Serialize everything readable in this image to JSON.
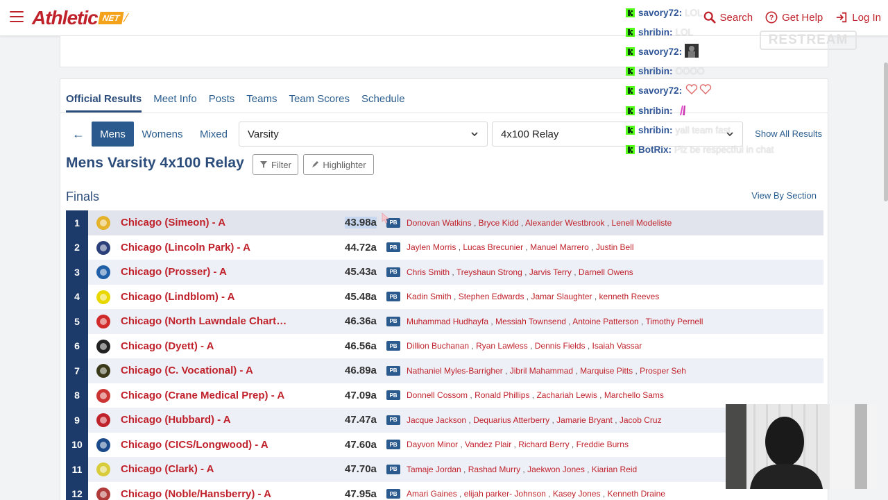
{
  "header": {
    "logo_main": "thletic",
    "logo_letter": "A",
    "logo_net": "NET",
    "links": [
      {
        "label": "Search",
        "icon": "search-icon"
      },
      {
        "label": "Get Help",
        "icon": "help-icon"
      },
      {
        "label": "Log In",
        "icon": "login-icon"
      }
    ]
  },
  "tabs": [
    "Official Results",
    "Meet Info",
    "Posts",
    "Teams",
    "Team Scores",
    "Schedule"
  ],
  "filters": {
    "genders": [
      "Mens",
      "Womens",
      "Mixed"
    ],
    "division": "Varsity",
    "event": "4x100 Relay",
    "show_all": "Show All Results"
  },
  "event_title": "Mens Varsity 4x100 Relay",
  "buttons": {
    "filter": "Filter",
    "highlighter": "Highlighter"
  },
  "section": {
    "title": "Finals",
    "view_by": "View By Section"
  },
  "pb_label": "PB",
  "results": [
    {
      "place": "1",
      "team": "Chicago (Simeon) - A",
      "time": "43.98a",
      "athletes": [
        "Donovan Watkins",
        "Bryce Kidd",
        "Alexander Westbrook",
        "Lenell Modeliste"
      ]
    },
    {
      "place": "2",
      "team": "Chicago (Lincoln Park) - A",
      "time": "44.72a",
      "athletes": [
        "Jaylen Morris",
        "Lucas Brecunier",
        "Manuel Marrero",
        "Justin Bell"
      ]
    },
    {
      "place": "3",
      "team": "Chicago (Prosser) - A",
      "time": "45.43a",
      "athletes": [
        "Chris Smith",
        "Treyshaun Strong",
        "Jarvis Terry",
        "Darnell Owens"
      ]
    },
    {
      "place": "4",
      "team": "Chicago (Lindblom) - A",
      "time": "45.48a",
      "athletes": [
        "Kadin Smith",
        "Stephen Edwards",
        "Jamar Slaughter",
        "kenneth Reeves"
      ]
    },
    {
      "place": "5",
      "team": "Chicago (North Lawndale Charter)…",
      "time": "46.36a",
      "athletes": [
        "Muhammad Hudhayfa",
        "Messiah Townsend",
        "Antoine Patterson",
        "Timothy Pernell"
      ]
    },
    {
      "place": "6",
      "team": "Chicago (Dyett) - A",
      "time": "46.56a",
      "athletes": [
        "Dillion Buchanan",
        "Ryan Lawless",
        "Dennis Fields",
        "Isaiah Vassar"
      ]
    },
    {
      "place": "7",
      "team": "Chicago (C. Vocational) - A",
      "time": "46.89a",
      "athletes": [
        "Nathaniel Myles-Barrigher",
        "Jibril Mahammad",
        "Marquise Pitts",
        "Prosper Seh"
      ]
    },
    {
      "place": "8",
      "team": "Chicago (Crane Medical Prep) - A",
      "time": "47.09a",
      "athletes": [
        "Donnell Cossom",
        "Ronald Phillips",
        "Zachariah Lewis",
        "Marchello Sams"
      ]
    },
    {
      "place": "9",
      "team": "Chicago (Hubbard) - A",
      "time": "47.47a",
      "athletes": [
        "Jacque Jackson",
        "Dequarius Atterberry",
        "Jamarie Bryant",
        "Jacob Cruz"
      ]
    },
    {
      "place": "10",
      "team": "Chicago (CICS/Longwood) - A",
      "time": "47.60a",
      "athletes": [
        "Dayvon Minor",
        "Vandez Plair",
        "Richard Berry",
        "Freddie Burns"
      ]
    },
    {
      "place": "11",
      "team": "Chicago (Clark) - A",
      "time": "47.70a",
      "athletes": [
        "Tamaje Jordan",
        "Rashad Murry",
        "Jaekwon Jones",
        "Kiarian Reid"
      ]
    },
    {
      "place": "12",
      "team": "Chicago (Noble/Hansberry) - A",
      "time": "47.95a",
      "athletes": [
        "Amari Gaines",
        "elijah parker- Johnson",
        "Kasey Jones",
        "Kenneth Draine"
      ]
    }
  ],
  "chat": [
    {
      "user": "savory72",
      "text": "LOL"
    },
    {
      "user": "shribin",
      "text": "LOL"
    },
    {
      "user": "savory72",
      "text": "",
      "emote": "person-emote"
    },
    {
      "user": "shribin",
      "text": "OOOO"
    },
    {
      "user": "savory72",
      "text": "",
      "emote": "hearts-emote"
    },
    {
      "user": "shribin",
      "text": "",
      "emote": "pray-emote"
    },
    {
      "user": "shribin",
      "text": "yall team fast"
    },
    {
      "user": "BotRix",
      "text": "Plz be respectful in chat"
    }
  ],
  "restream_label": "RESTREAM",
  "colors": {
    "brand_red": "#c0222b",
    "navy": "#1c3a6a",
    "link_blue": "#2a5d8f",
    "kick_green": "#53fc18"
  }
}
